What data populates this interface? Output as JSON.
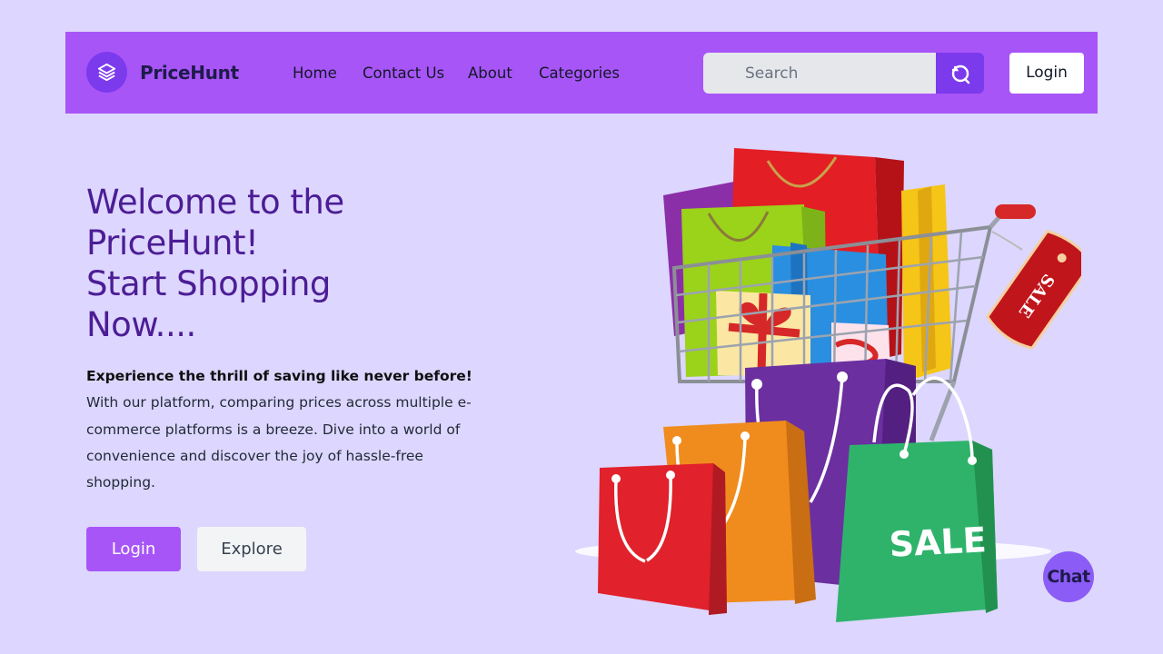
{
  "nav": {
    "brand": "PriceHunt",
    "logo_icon": "layers-icon",
    "links": [
      "Home",
      "Contact Us",
      "About",
      "Categories"
    ],
    "search_placeholder": "Search",
    "search_icon": "search-icon",
    "login_label": "Login"
  },
  "hero": {
    "title_lines": [
      "Welcome to the",
      "PriceHunt!",
      "Start Shopping",
      "Now...."
    ],
    "tagline": "Experience the thrill of saving like never before!",
    "description": "With our platform, comparing prices across multiple e-commerce platforms is a breeze. Dive into a world of convenience and discover the joy of hassle-free shopping.",
    "primary_button": "Login",
    "secondary_button": "Explore"
  },
  "illustration": {
    "tag_text": "SALE",
    "bag_text": "SALE"
  },
  "chat": {
    "label": "Chat"
  },
  "colors": {
    "background": "#ddd6fe",
    "navbar": "#a855f7",
    "accent": "#7c3aed",
    "title": "#4c1d95"
  }
}
